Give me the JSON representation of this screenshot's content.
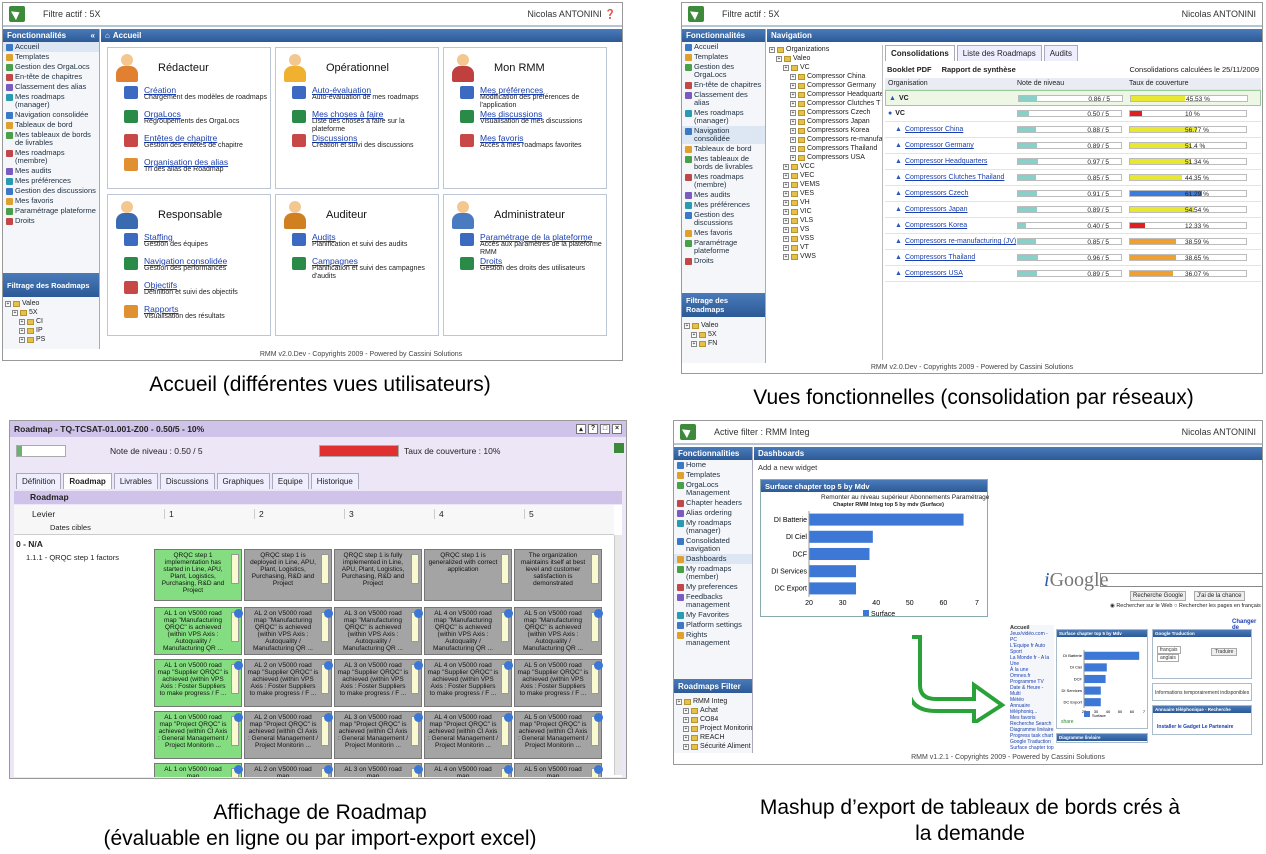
{
  "captions": {
    "p1": "Accueil (différentes vues utilisateurs)",
    "p2": "Vues fonctionnelles (consolidation par réseaux)",
    "p3a": "Affichage de Roadmap",
    "p3b": "(évaluable en ligne ou par import-export excel)",
    "p4a": "Mashup d’export de tableaux de bords crés à",
    "p4b": "la demande"
  },
  "p1": {
    "filter": "Filtre actif : 5X",
    "user": "Nicolas ANTONINI",
    "side_title": "Fonctionnalités",
    "main_title": "Accueil",
    "side_items": [
      "Accueil",
      "Templates",
      "Gestion des OrgaLocs",
      "En-tête de chapitres",
      "Classement des alias",
      "Mes roadmaps (manager)",
      "Navigation consolidée",
      "Tableaux de bord",
      "Mes tableaux de bords de livrables",
      "Mes roadmaps (membre)",
      "Mes audits",
      "Mes préférences",
      "Gestion des discussions",
      "Mes favoris",
      "Paramétrage plateforme",
      "Droits"
    ],
    "filter_title": "Filtrage des Roadmaps",
    "filter_tree": [
      "Valeo",
      "5X",
      "CI",
      "IP",
      "PS"
    ],
    "cards": [
      {
        "title": "Rédacteur",
        "links": [
          {
            "t": "Création",
            "d": "Chargement des modèles de roadmaps"
          },
          {
            "t": "OrgaLocs",
            "d": "Regroupements des OrgaLocs"
          },
          {
            "t": "Entêtes de chapitre",
            "d": "Gestion des entêtes de chapitre"
          },
          {
            "t": "Organisation des alias",
            "d": "Tri des alias de Roadmap"
          }
        ]
      },
      {
        "title": "Opérationnel",
        "links": [
          {
            "t": "Auto-évaluation",
            "d": "Auto-évaluation de mes roadmaps"
          },
          {
            "t": "Mes choses à faire",
            "d": "Liste des choses à faire sur la plateforme"
          },
          {
            "t": "Discussions",
            "d": "Création et suivi des discussions"
          }
        ]
      },
      {
        "title": "Mon RMM",
        "links": [
          {
            "t": "Mes préférences",
            "d": "Modification des préférences de l'application"
          },
          {
            "t": "Mes discussions",
            "d": "Visualisation de mes discussions"
          },
          {
            "t": "Mes favoris",
            "d": "Accès à mes roadmaps favorites"
          }
        ]
      },
      {
        "title": "Responsable",
        "links": [
          {
            "t": "Staffing",
            "d": "Gestion des équipes"
          },
          {
            "t": "Navigation consolidée",
            "d": "Gestion des performances"
          },
          {
            "t": "Objectifs",
            "d": "Définition et suivi des objectifs"
          },
          {
            "t": "Rapports",
            "d": "Visualisation des résultats"
          }
        ]
      },
      {
        "title": "Auditeur",
        "links": [
          {
            "t": "Audits",
            "d": "Planification et suivi des audits"
          },
          {
            "t": "Campagnes",
            "d": "Planification et suivi des campagnes d'audits"
          }
        ]
      },
      {
        "title": "Administrateur",
        "links": [
          {
            "t": "Paramétrage de la plateforme",
            "d": "Accès aux paramètres de la plateforme RMM"
          },
          {
            "t": "Droits",
            "d": "Gestion des droits des utilisateurs"
          }
        ]
      }
    ],
    "footer": "RMM v2.0.Dev - Copyrights 2009 - Powered by Cassini Solutions"
  },
  "p2": {
    "filter": "Filtre actif : 5X",
    "user": "Nicolas ANTONINI",
    "side_title": "Fonctionnalités",
    "nav_title": "Navigation",
    "side_items": [
      "Accueil",
      "Templates",
      "Gestion des OrgaLocs",
      "En-tête de chapitres",
      "Classement des alias",
      "Mes roadmaps (manager)",
      "Navigation consolidée",
      "Tableaux de bord",
      "Mes tableaux de bords de livrables",
      "Mes roadmaps (membre)",
      "Mes audits",
      "Mes préférences",
      "Gestion des discussions",
      "Mes favoris",
      "Paramétrage plateforme",
      "Droits"
    ],
    "filter_title": "Filtrage des Roadmaps",
    "filter_tree": [
      "Valeo",
      "5X",
      "FN"
    ],
    "org_tree": [
      "Organizations",
      "Valeo",
      "VC",
      "Compressor China",
      "Compressor Germany",
      "Compressor Headquarters",
      "Compressor Clutches T",
      "Compressors Czech",
      "Compressors Japan",
      "Compressors Korea",
      "Compressors re-manufa",
      "Compressors Thailand",
      "Compressors USA",
      "VCC",
      "VEC",
      "VEMS",
      "VES",
      "VH",
      "VIC",
      "VLS",
      "VS",
      "VSS",
      "VT",
      "VWS"
    ],
    "tabs": [
      "Consolidations",
      "Liste des Roadmaps",
      "Audits"
    ],
    "booklet": "Booklet PDF",
    "synth": "Rapport de synthèse",
    "calc": "Consolidations calculées le 25/11/2009",
    "cols": [
      "Organisation",
      "Note de niveau",
      "Taux de couverture"
    ],
    "rows": [
      {
        "name": "VC",
        "note": "0.86 / 5",
        "nv": 0.86,
        "cov": "45.53 %",
        "cv": 45.53,
        "cc": "#e8e832"
      },
      {
        "name": "VC",
        "note": "0.50 / 5",
        "nv": 0.5,
        "cov": "10 %",
        "cv": 10,
        "cc": "#e02020"
      },
      {
        "name": "Compressor China",
        "note": "0.88 / 5",
        "nv": 0.88,
        "cov": "56.77 %",
        "cv": 56.77,
        "cc": "#e8e832"
      },
      {
        "name": "Compressor Germany",
        "note": "0.89 / 5",
        "nv": 0.89,
        "cov": "51.4 %",
        "cv": 51.4,
        "cc": "#e8e832"
      },
      {
        "name": "Compressor Headquarters",
        "note": "0.97 / 5",
        "nv": 0.97,
        "cov": "51.34 %",
        "cv": 51.34,
        "cc": "#e8e832"
      },
      {
        "name": "Compressors Clutches Thailand",
        "note": "0.85 / 5",
        "nv": 0.85,
        "cov": "44.35 %",
        "cv": 44.35,
        "cc": "#e8e832"
      },
      {
        "name": "Compressors Czech",
        "note": "0.91 / 5",
        "nv": 0.91,
        "cov": "61.29 %",
        "cv": 61.29,
        "cc": "#3b7be0"
      },
      {
        "name": "Compressors Japan",
        "note": "0.89 / 5",
        "nv": 0.89,
        "cov": "54.54 %",
        "cv": 54.54,
        "cc": "#e8e832"
      },
      {
        "name": "Compressors Korea",
        "note": "0.40 / 5",
        "nv": 0.4,
        "cov": "12.33 %",
        "cv": 12.33,
        "cc": "#e02020"
      },
      {
        "name": "Compressors re-manufacturing (JV)",
        "note": "0.85 / 5",
        "nv": 0.85,
        "cov": "38.59 %",
        "cv": 38.59,
        "cc": "#f0a030"
      },
      {
        "name": "Compressors Thailand",
        "note": "0.96 / 5",
        "nv": 0.96,
        "cov": "38.65 %",
        "cv": 38.65,
        "cc": "#f0a030"
      },
      {
        "name": "Compressors USA",
        "note": "0.89 / 5",
        "nv": 0.89,
        "cov": "36.07 %",
        "cv": 36.07,
        "cc": "#f0a030"
      }
    ],
    "footer": "RMM v2.0.Dev - Copyrights 2009 - Powered by Cassini Solutions"
  },
  "p3": {
    "title": "Roadmap - TQ-TCSAT-01.001-Z00 - 0.50/5 - 10%",
    "note": "Note de niveau : 0.50 / 5",
    "note_value": 0.5,
    "cov": "Taux de couverture : 10%",
    "cov_value": 10,
    "tabs": [
      "Définition",
      "Roadmap",
      "Livrables",
      "Discussions",
      "Graphiques",
      "Equipe",
      "Historique"
    ],
    "section": "Roadmap",
    "levier": "Levier",
    "dates": "Dates cibles",
    "levels": [
      "1",
      "2",
      "3",
      "4",
      "5"
    ],
    "group": "0 - N/A",
    "factor": "1.1.1 - QRQC step 1 factors",
    "row1": [
      "QRQC step 1 implementation has started in Line, APU, Plant, Logistics, Purchasing, R&D and Project",
      "QRQC step 1 is deployed in Line, APU, Plant, Logistics, Purchasing, R&D and Project",
      "QRQC step 1 is fully implemented in Line, APU, Plant, Logistics, Purchasing, R&D and Project",
      "QRQC step 1 is generalized with correct application",
      "The organization maintains itself at best level and customer satisfaction is demonstrated"
    ],
    "rows": [
      [
        "AL 1 on V5000 road map \"Manufacturing QRQC\" is achieved (within VPS Axis : Autoquality / Manufacturing QR ...",
        "AL 2 on V5000 road map \"Manufacturing QRQC\" is achieved (within VPS Axis : Autoquality / Manufacturing QR ...",
        "AL 3 on V5000 road map \"Manufacturing QRQC\" is achieved (within VPS Axis : Autoquality / Manufacturing QR ...",
        "AL 4 on V5000 road map \"Manufacturing QRQC\" is achieved (within VPS Axis : Autoquality / Manufacturing QR ...",
        "AL 5 on V5000 road map \"Manufacturing QRQC\" is achieved (within VPS Axis : Autoquality / Manufacturing QR ..."
      ],
      [
        "AL 1 on V5000 road map \"Supplier QRQC\" is achieved (within VPS Axis : Foster Suppliers to make progress / F ...",
        "AL 2 on V5000 road map \"Supplier QRQC\" is achieved (within VPS Axis : Foster Suppliers to make progress / F ...",
        "AL 3 on V5000 road map \"Supplier QRQC\" is achieved (within VPS Axis : Foster Suppliers to make progress / F ...",
        "AL 4 on V5000 road map \"Supplier QRQC\" is achieved (within VPS Axis : Foster Suppliers to make progress / F ...",
        "AL 5 on V5000 road map \"Supplier QRQC\" is achieved (within VPS Axis : Foster Suppliers to make progress / F ..."
      ],
      [
        "AL 1 on V5000 road map \"Project QRQC\" is achieved (within CI Axis : General Management / Project Monitorin ...",
        "AL 2 on V5000 road map \"Project QRQC\" is achieved (within CI Axis : General Management / Project Monitorin ...",
        "AL 3 on V5000 road map \"Project QRQC\" is achieved (within CI Axis : General Management / Project Monitorin ...",
        "AL 4 on V5000 road map \"Project QRQC\" is achieved (within CI Axis : General Management / Project Monitorin ...",
        "AL 5 on V5000 road map \"Project QRQC\" is achieved (within CI Axis : General Management / Project Monitorin ..."
      ],
      [
        "AL 1 on V5000 road map",
        "AL 2 on V5000 road map",
        "AL 3 on V5000 road map",
        "AL 4 on V5000 road map",
        "AL 5 on V5000 road map"
      ]
    ]
  },
  "p4": {
    "filter": "Active filter : RMM Integ",
    "user": "Nicolas ANTONINI",
    "side_title": "Fonctionnalities",
    "dash_title": "Dashboards",
    "add_widget": "Add a new widget",
    "side_items": [
      "Home",
      "Templates",
      "OrgaLocs Management",
      "Chapter headers",
      "Alias ordering",
      "My roadmaps (manager)",
      "Consolidated navigation",
      "Dashboards",
      "My roadmaps (member)",
      "My preferences",
      "Feedbacks management",
      "My Favorites",
      "Platform settings",
      "Rights management"
    ],
    "filter_title": "Roadmaps Filter",
    "filter_tree": [
      "RMM Integ",
      "Achat",
      "CO84",
      "Project Monitorin",
      "REACH",
      "Sécurité Aliment"
    ],
    "widget": {
      "title": "Surface chapter top 5 by Mdv",
      "menu": "Remonter au niveau supérieur  Abonnements  Paramétrage",
      "subtitle": "Chapter RMM Integ top 5 by mdv (Surface)",
      "legend": "Surface"
    },
    "igoogle": {
      "logo_i": "i",
      "logo_g": "Google",
      "btn1": "Recherche Google",
      "btn2": "J'ai de la chance",
      "opt1": "Rechercher sur le Web",
      "opt2": "Rechercher les pages en français",
      "changes": "Changer de",
      "accueil": "Accueil",
      "w1": "Surface chapter top 5 by Mdv",
      "w2": "Google Traduction",
      "w3": "Annuaire téléphonique - Recherche",
      "w4": "Diagramme linéaire",
      "traduire": "Traduire",
      "lang1": "français",
      "lang2": "anglais",
      "info": "Informations temporairement indisponibles",
      "install": "Installer le Gadget Le Partenaire",
      "share": "share"
    },
    "footer": "RMM v1.2.1 - Copyrights 2009 - Powered by Cassini Solutions"
  },
  "chart_data": {
    "type": "bar",
    "orientation": "horizontal",
    "title": "Chapter RMM Integ top 5 by mdv (Surface)",
    "categories": [
      "DI Batterie",
      "DI Ciel",
      "DCF",
      "DI Services",
      "DC Export"
    ],
    "series": [
      {
        "name": "Surface",
        "values": [
          66,
          39,
          38,
          34,
          34
        ]
      }
    ],
    "xlim": [
      20,
      70
    ],
    "xticks": [
      "20",
      "30",
      "40",
      "50",
      "60",
      "7"
    ],
    "color": "#3e78d6"
  }
}
